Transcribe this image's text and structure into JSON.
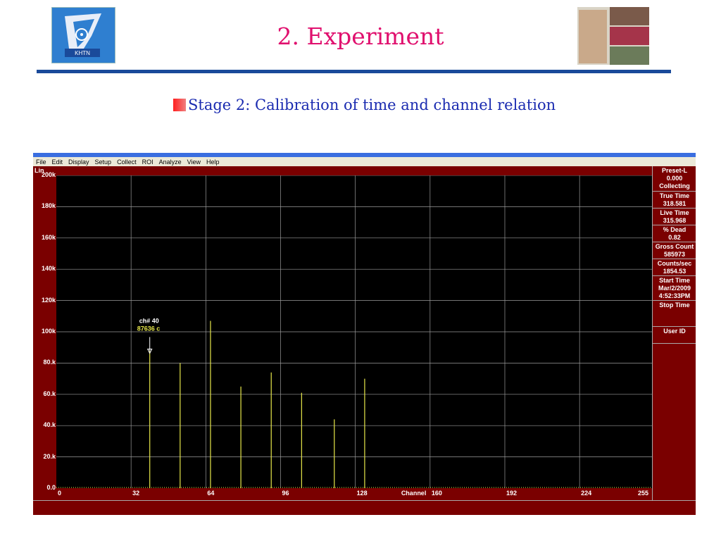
{
  "slide": {
    "title": "2. Experiment",
    "subtitle": "Stage 2: Calibration of time and channel relation",
    "logo_text": "KHTN"
  },
  "app": {
    "menu": [
      "File",
      "Edit",
      "Display",
      "Setup",
      "Collect",
      "ROI",
      "Analyze",
      "View",
      "Help"
    ],
    "scale_mode": "Lin",
    "marker": {
      "channel_label": "ch# 40",
      "counts_label": "87636 c",
      "channel": 40,
      "counts": 87636
    },
    "sidebar": [
      {
        "label": "Preset-L",
        "value": "0.000"
      },
      {
        "label": "Collecting",
        "value": ""
      },
      {
        "label": "True Time",
        "value": "318.581"
      },
      {
        "label": "Live Time",
        "value": "315.968"
      },
      {
        "label": "% Dead",
        "value": "0.82"
      },
      {
        "label": "Gross Count",
        "value": "585973"
      },
      {
        "label": "Counts/sec",
        "value": "1854.53"
      },
      {
        "label": "Start Time",
        "value": "Mar/2/2009 4:52:33PM"
      },
      {
        "label": "Stop Time",
        "value": ""
      },
      {
        "label": "User ID",
        "value": ""
      }
    ]
  },
  "chart_data": {
    "type": "bar",
    "xlabel": "Channel",
    "ylabel": "",
    "xlim": [
      0,
      255
    ],
    "ylim": [
      0,
      200000
    ],
    "x_ticks": [
      "0",
      "32",
      "64",
      "96",
      "128",
      "160",
      "192",
      "224",
      "255"
    ],
    "x_tick_values": [
      0,
      32,
      64,
      96,
      128,
      160,
      192,
      224,
      255
    ],
    "y_ticks": [
      "0.0",
      "20.k",
      "40.k",
      "60.k",
      "80.k",
      "100k",
      "120k",
      "140k",
      "160k",
      "180k",
      "200k"
    ],
    "y_tick_values": [
      0,
      20000,
      40000,
      60000,
      80000,
      100000,
      120000,
      140000,
      160000,
      180000,
      200000
    ],
    "grid": true,
    "series": [
      {
        "color": "#e8e84a",
        "points": [
          {
            "x": 40,
            "y": 87636
          },
          {
            "x": 53,
            "y": 80000
          },
          {
            "x": 66,
            "y": 107000
          },
          {
            "x": 79,
            "y": 65000
          },
          {
            "x": 92,
            "y": 74000
          },
          {
            "x": 105,
            "y": 61000
          },
          {
            "x": 119,
            "y": 44000
          },
          {
            "x": 132,
            "y": 70000
          }
        ]
      }
    ]
  }
}
